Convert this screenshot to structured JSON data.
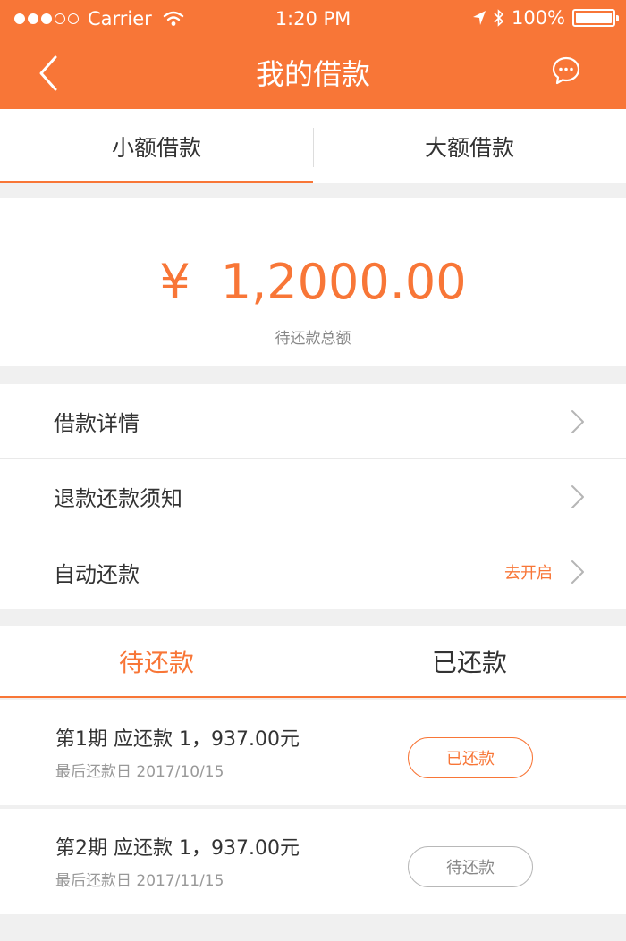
{
  "status_bar": {
    "carrier": "Carrier",
    "time": "1:20 PM",
    "battery_text": "100%",
    "battery_level": 1.0,
    "signal_bars_filled": 3,
    "signal_bars_total": 5
  },
  "nav": {
    "title": "我的借款",
    "back_icon": "chevron-left-icon",
    "chat_icon": "chat-bubble-icon"
  },
  "top_tabs": [
    {
      "label": "小额借款",
      "active": true
    },
    {
      "label": "大额借款",
      "active": false
    }
  ],
  "summary": {
    "currency": "¥",
    "amount": "1,2000.00",
    "label": "待还款总额"
  },
  "menu": [
    {
      "label": "借款详情",
      "extra": ""
    },
    {
      "label": "退款还款须知",
      "extra": ""
    },
    {
      "label": "自动还款",
      "extra": "去开启"
    }
  ],
  "repay_tabs": [
    {
      "label": "待还款",
      "active": true
    },
    {
      "label": "已还款",
      "active": false
    }
  ],
  "installments": [
    {
      "title": "第1期 应还款 1，937.00元",
      "date": "最后还款日 2017/10/15",
      "status": "已还款",
      "state": "paid"
    },
    {
      "title": "第2期 应还款 1，937.00元",
      "date": "最后还款日 2017/11/15",
      "status": "待还款",
      "state": "pending"
    }
  ],
  "colors": {
    "accent": "#f87637",
    "page_bg": "#f0f0f0"
  }
}
